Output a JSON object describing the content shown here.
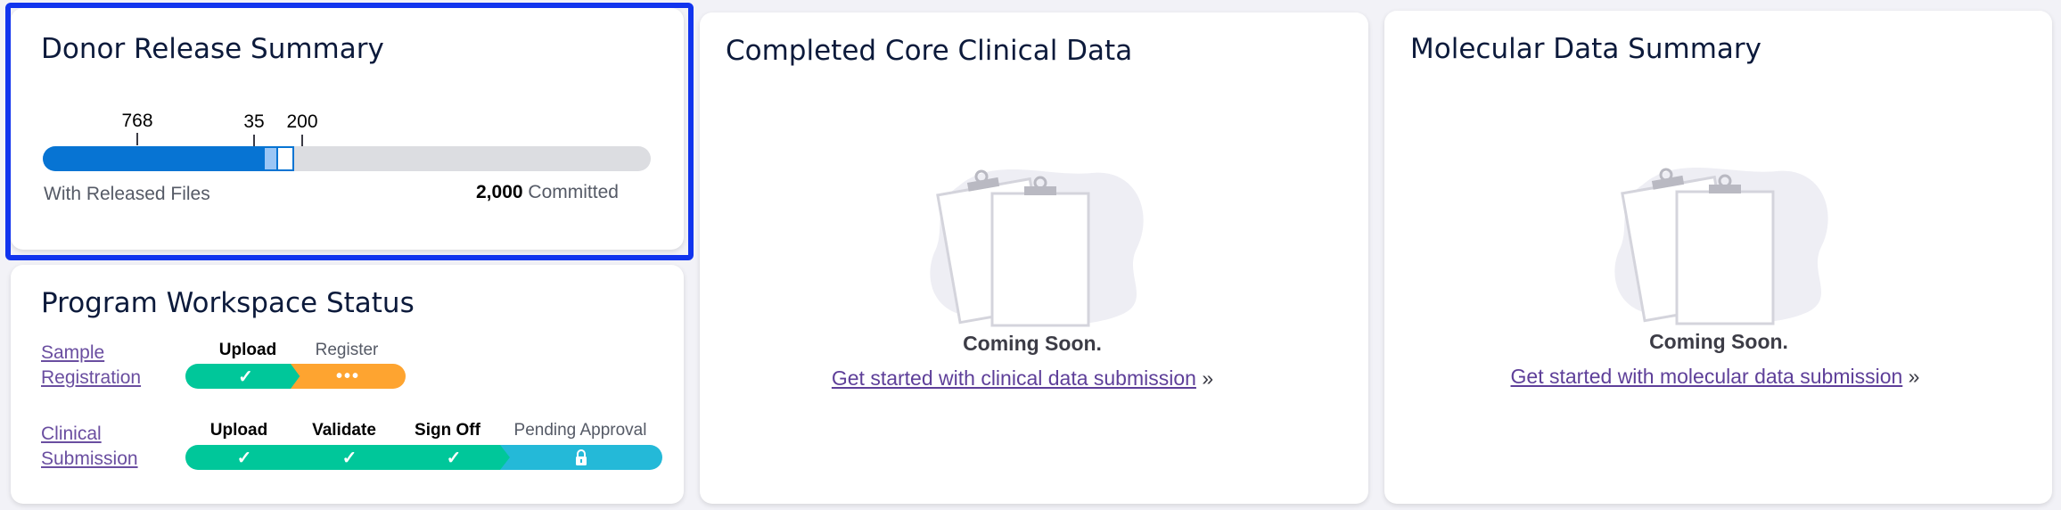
{
  "donor": {
    "title": "Donor Release Summary",
    "released_value": "768",
    "registered_value": "35",
    "committed_marker_value": "200",
    "released_label": "With Released Files",
    "committed_value": "2,000",
    "committed_label": "Committed",
    "total": 2000,
    "segments": [
      768,
      35,
      200
    ]
  },
  "workspace": {
    "title": "Program Workspace Status",
    "sample": {
      "link": "Sample Registration",
      "steps": [
        "Upload",
        "Register"
      ]
    },
    "clinical": {
      "link": "Clinical Submission",
      "steps": [
        "Upload",
        "Validate",
        "Sign Off",
        "Pending Approval"
      ]
    }
  },
  "clinical_card": {
    "title": "Completed Core Clinical Data",
    "coming_soon": "Coming Soon.",
    "cta": "Get started with clinical data submission",
    "arrow": "»"
  },
  "molecular_card": {
    "title": "Molecular Data Summary",
    "coming_soon": "Coming Soon.",
    "cta": "Get started with molecular data submission",
    "arrow": "»"
  },
  "colors": {
    "released": "#0774d3",
    "registered": "#9bc6f5",
    "committed_outline": "#0774d3",
    "done_step": "#00c79a",
    "active_step": "#fea430",
    "locked_step": "#24b9d8",
    "selection_outline": "#1134ee"
  },
  "icons": {
    "done": "check-icon",
    "in_progress": "ellipsis-icon",
    "locked": "lock-icon",
    "empty_state": "clipboard-icon"
  }
}
